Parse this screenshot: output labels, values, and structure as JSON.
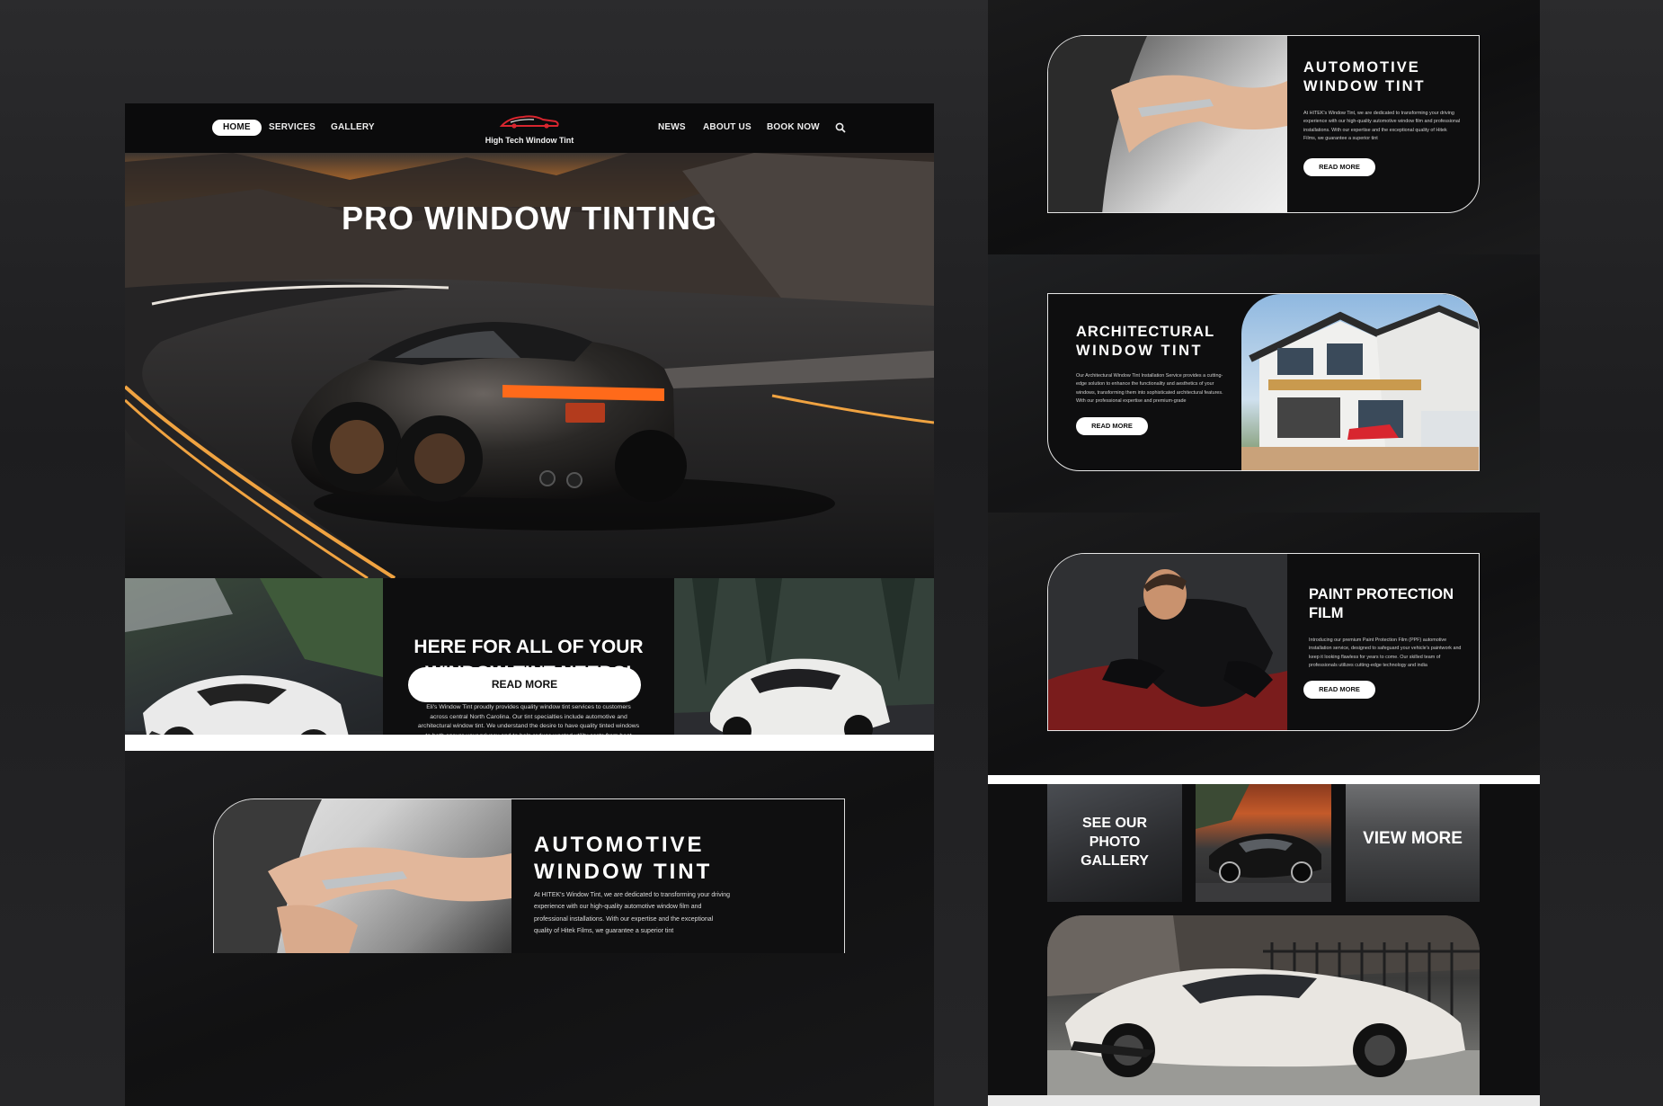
{
  "nav": {
    "home": "HOME",
    "services": "SERVICES",
    "gallery": "GALLERY",
    "news": "NEWS",
    "about": "ABOUT US",
    "book": "BOOK NOW",
    "logo_text": "High Tech Window Tint"
  },
  "hero": {
    "title": "PRO WINDOW TINTING"
  },
  "intro": {
    "title_line1": "HERE FOR ALL OF YOUR",
    "title_line2": "WINDOW TINT NEEDS!",
    "body": "Eli's Window Tint proudly provides quality window tint services to customers across central North Carolina. Our tint specialties include automotive and architectural window tint. We understand the desire to have quality tinted windows to both ensure your privacy and to help reduce wasted utility costs from heat exposure in your home or in your place of business. We proudly deliver prompt, five star services and offer an industry leading warranty on the workmanship of all of our tint services that ensures you complete peace-of-mind.",
    "button": "READ MORE"
  },
  "lower": {
    "title_line1": "AUTOMOTIVE",
    "title_line2": "WINDOW TINT",
    "body": "At HITEK's Window Tint, we are dedicated to transforming your driving experience with our high-quality automotive window film and professional installations. With our expertise and the exceptional quality of Hitek Films, we guarantee a superior tint"
  },
  "cards": {
    "automotive": {
      "title_line1": "AUTOMOTIVE",
      "title_line2": "WINDOW TINT",
      "body": "At HITEK's Window Tint, we are dedicated to transforming your driving experience with our high-quality automotive window film and professional installations. With our expertise and the exceptional quality of Hitek Films, we guarantee a superior tint",
      "button": "READ MORE"
    },
    "architectural": {
      "title_line1": "ARCHITECTURAL",
      "title_line2": "WINDOW TINT",
      "body": "Our Architectural Window Tint Installation Service provides a cutting-edge solution to enhance the functionality and aesthetics of your windows, transforming them into sophisticated architectural features. With our professional expertise and premium-grade",
      "button": "READ MORE"
    },
    "ppf": {
      "title_line1": "PAINT PROTECTION",
      "title_line2": "FILM",
      "body": "Introducing our premium Paint Protection Film (PPF) automotive installation service, designed to safeguard your vehicle's paintwork and keep it looking flawless for years to come. Our skilled team of professionals utilizes cutting-edge technology and india",
      "button": "READ MORE"
    }
  },
  "gallery": {
    "see_line1": "SEE OUR",
    "see_line2": "PHOTO",
    "see_line3": "GALLERY",
    "view_more": "VIEW MORE"
  },
  "colors": {
    "background": "#222224",
    "panel": "#0e0e0f",
    "accent_sunset": "#f0a341",
    "brake_light": "#ff6a1a",
    "logo_red": "#d8262f"
  }
}
